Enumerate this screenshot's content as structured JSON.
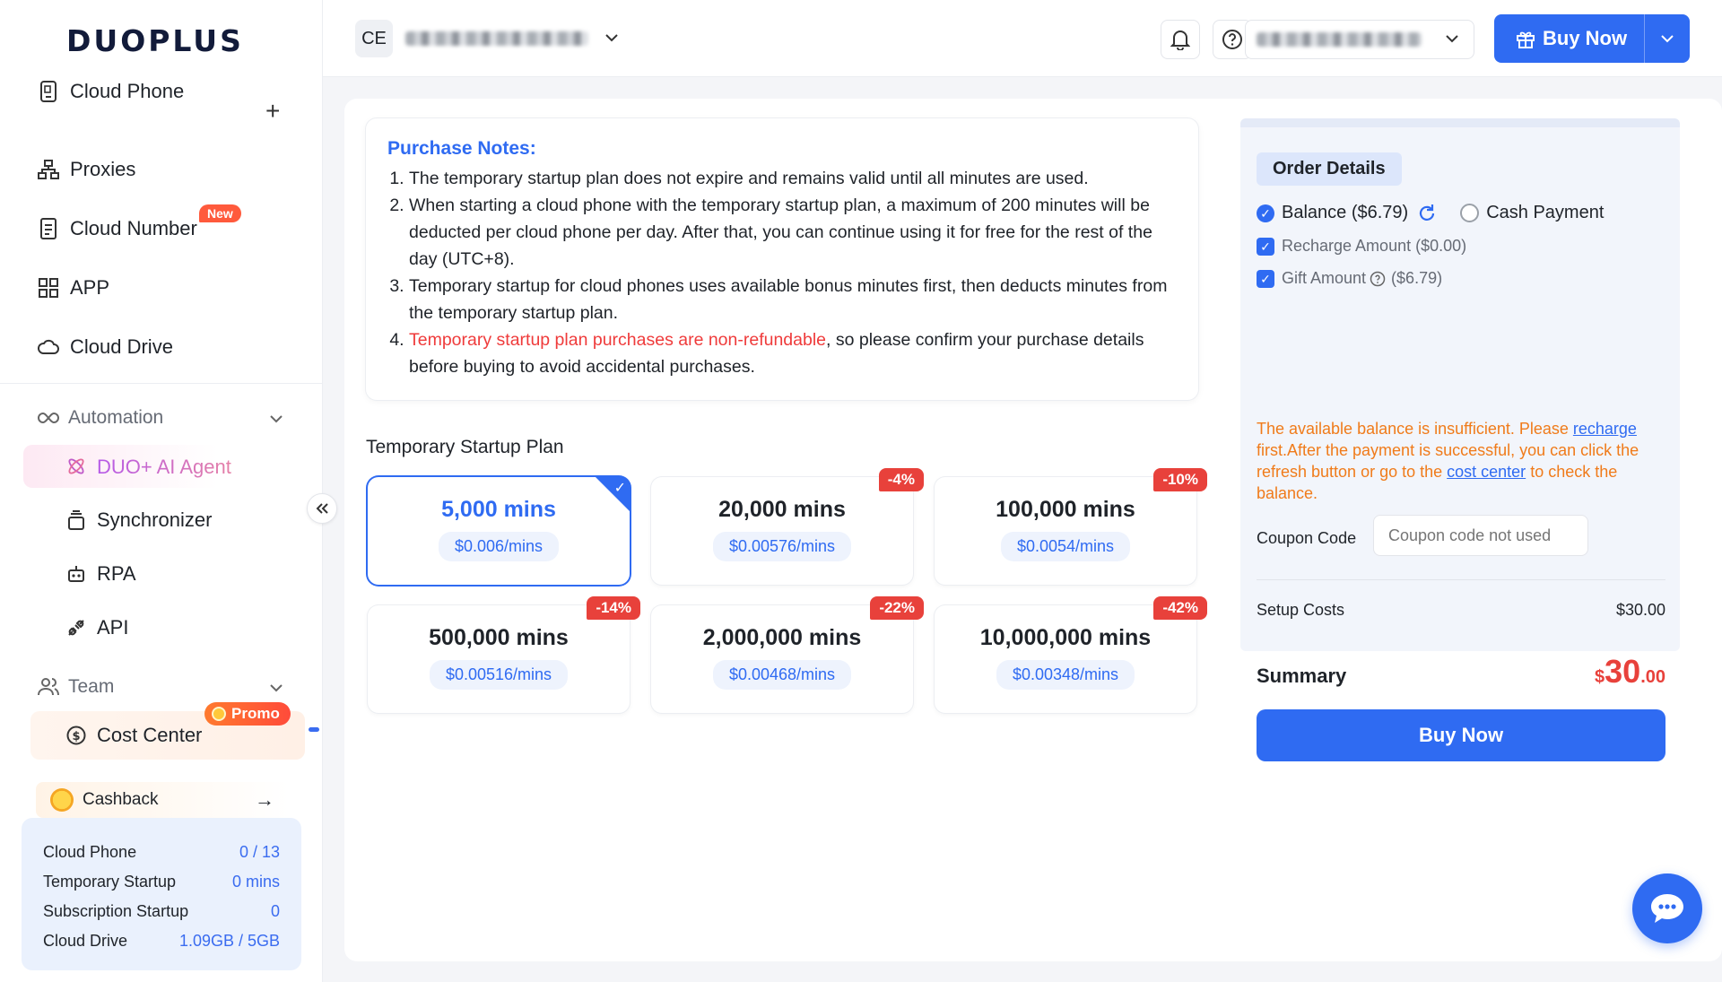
{
  "app": {
    "logo": "DUOPLUS"
  },
  "sidebar": {
    "items": [
      {
        "label": "Cloud Phone"
      },
      {
        "label": "Proxies"
      },
      {
        "label": "Cloud Number",
        "badge": "New"
      },
      {
        "label": "APP"
      },
      {
        "label": "Cloud Drive"
      }
    ],
    "automation": {
      "label": "Automation",
      "items": [
        {
          "label": "DUO+ AI Agent"
        },
        {
          "label": "Synchronizer"
        },
        {
          "label": "RPA"
        },
        {
          "label": "API"
        }
      ]
    },
    "team": {
      "label": "Team"
    },
    "cost_center": {
      "label": "Cost Center",
      "badge": "Promo"
    },
    "cashback": {
      "label": "Cashback"
    },
    "usage": [
      {
        "label": "Cloud Phone",
        "value": "0 / 13"
      },
      {
        "label": "Temporary Startup",
        "value": "0 mins"
      },
      {
        "label": "Subscription Startup",
        "value": "0"
      },
      {
        "label": "Cloud Drive",
        "value": "1.09GB / 5GB"
      }
    ]
  },
  "header": {
    "workspace_initials": "CE",
    "buy_now": "Buy Now"
  },
  "notes": {
    "title": "Purchase Notes:",
    "items": [
      "The temporary startup plan does not expire and remains valid until all minutes are used.",
      "When starting a cloud phone with the temporary startup plan, a maximum of 200 minutes will be deducted per cloud phone per day. After that, you can continue using it for free for the rest of the day (UTC+8).",
      "Temporary startup for cloud phones uses available bonus minutes first, then deducts minutes from the temporary startup plan."
    ],
    "item4_red": "Temporary startup plan purchases are non-refundable",
    "item4_rest": ", so please confirm your purchase details before buying to avoid accidental purchases."
  },
  "plans": {
    "title": "Temporary Startup Plan",
    "items": [
      {
        "mins": "5,000 mins",
        "price": "$0.006/mins",
        "discount": "",
        "selected": true
      },
      {
        "mins": "20,000 mins",
        "price": "$0.00576/mins",
        "discount": "-4%"
      },
      {
        "mins": "100,000 mins",
        "price": "$0.0054/mins",
        "discount": "-10%"
      },
      {
        "mins": "500,000 mins",
        "price": "$0.00516/mins",
        "discount": "-14%"
      },
      {
        "mins": "2,000,000 mins",
        "price": "$0.00468/mins",
        "discount": "-22%"
      },
      {
        "mins": "10,000,000 mins",
        "price": "$0.00348/mins",
        "discount": "-42%"
      }
    ]
  },
  "order": {
    "title": "Order Details",
    "balance": "Balance ($6.79)",
    "cash_payment": "Cash Payment",
    "recharge_amount": "Recharge Amount ($0.00)",
    "gift_amount_label": "Gift Amount",
    "gift_amount_value": "($6.79)",
    "warning_1": "The available balance is insufficient. Please ",
    "warning_link1": "recharge",
    "warning_2": " first.After the payment is successful, you can click the refresh button or go to the ",
    "warning_link2": "cost center",
    "warning_3": " to check the balance.",
    "coupon_label": "Coupon Code",
    "coupon_placeholder": "Coupon code not used",
    "setup_label": "Setup Costs",
    "setup_value": "$30.00",
    "summary_label": "Summary",
    "summary_currency": "$",
    "summary_int": "30",
    "summary_dec": ".00",
    "buy_now": "Buy Now"
  },
  "colors": {
    "accent": "#2f6bf2",
    "danger": "#e8413b",
    "warning": "#f07b1a"
  }
}
